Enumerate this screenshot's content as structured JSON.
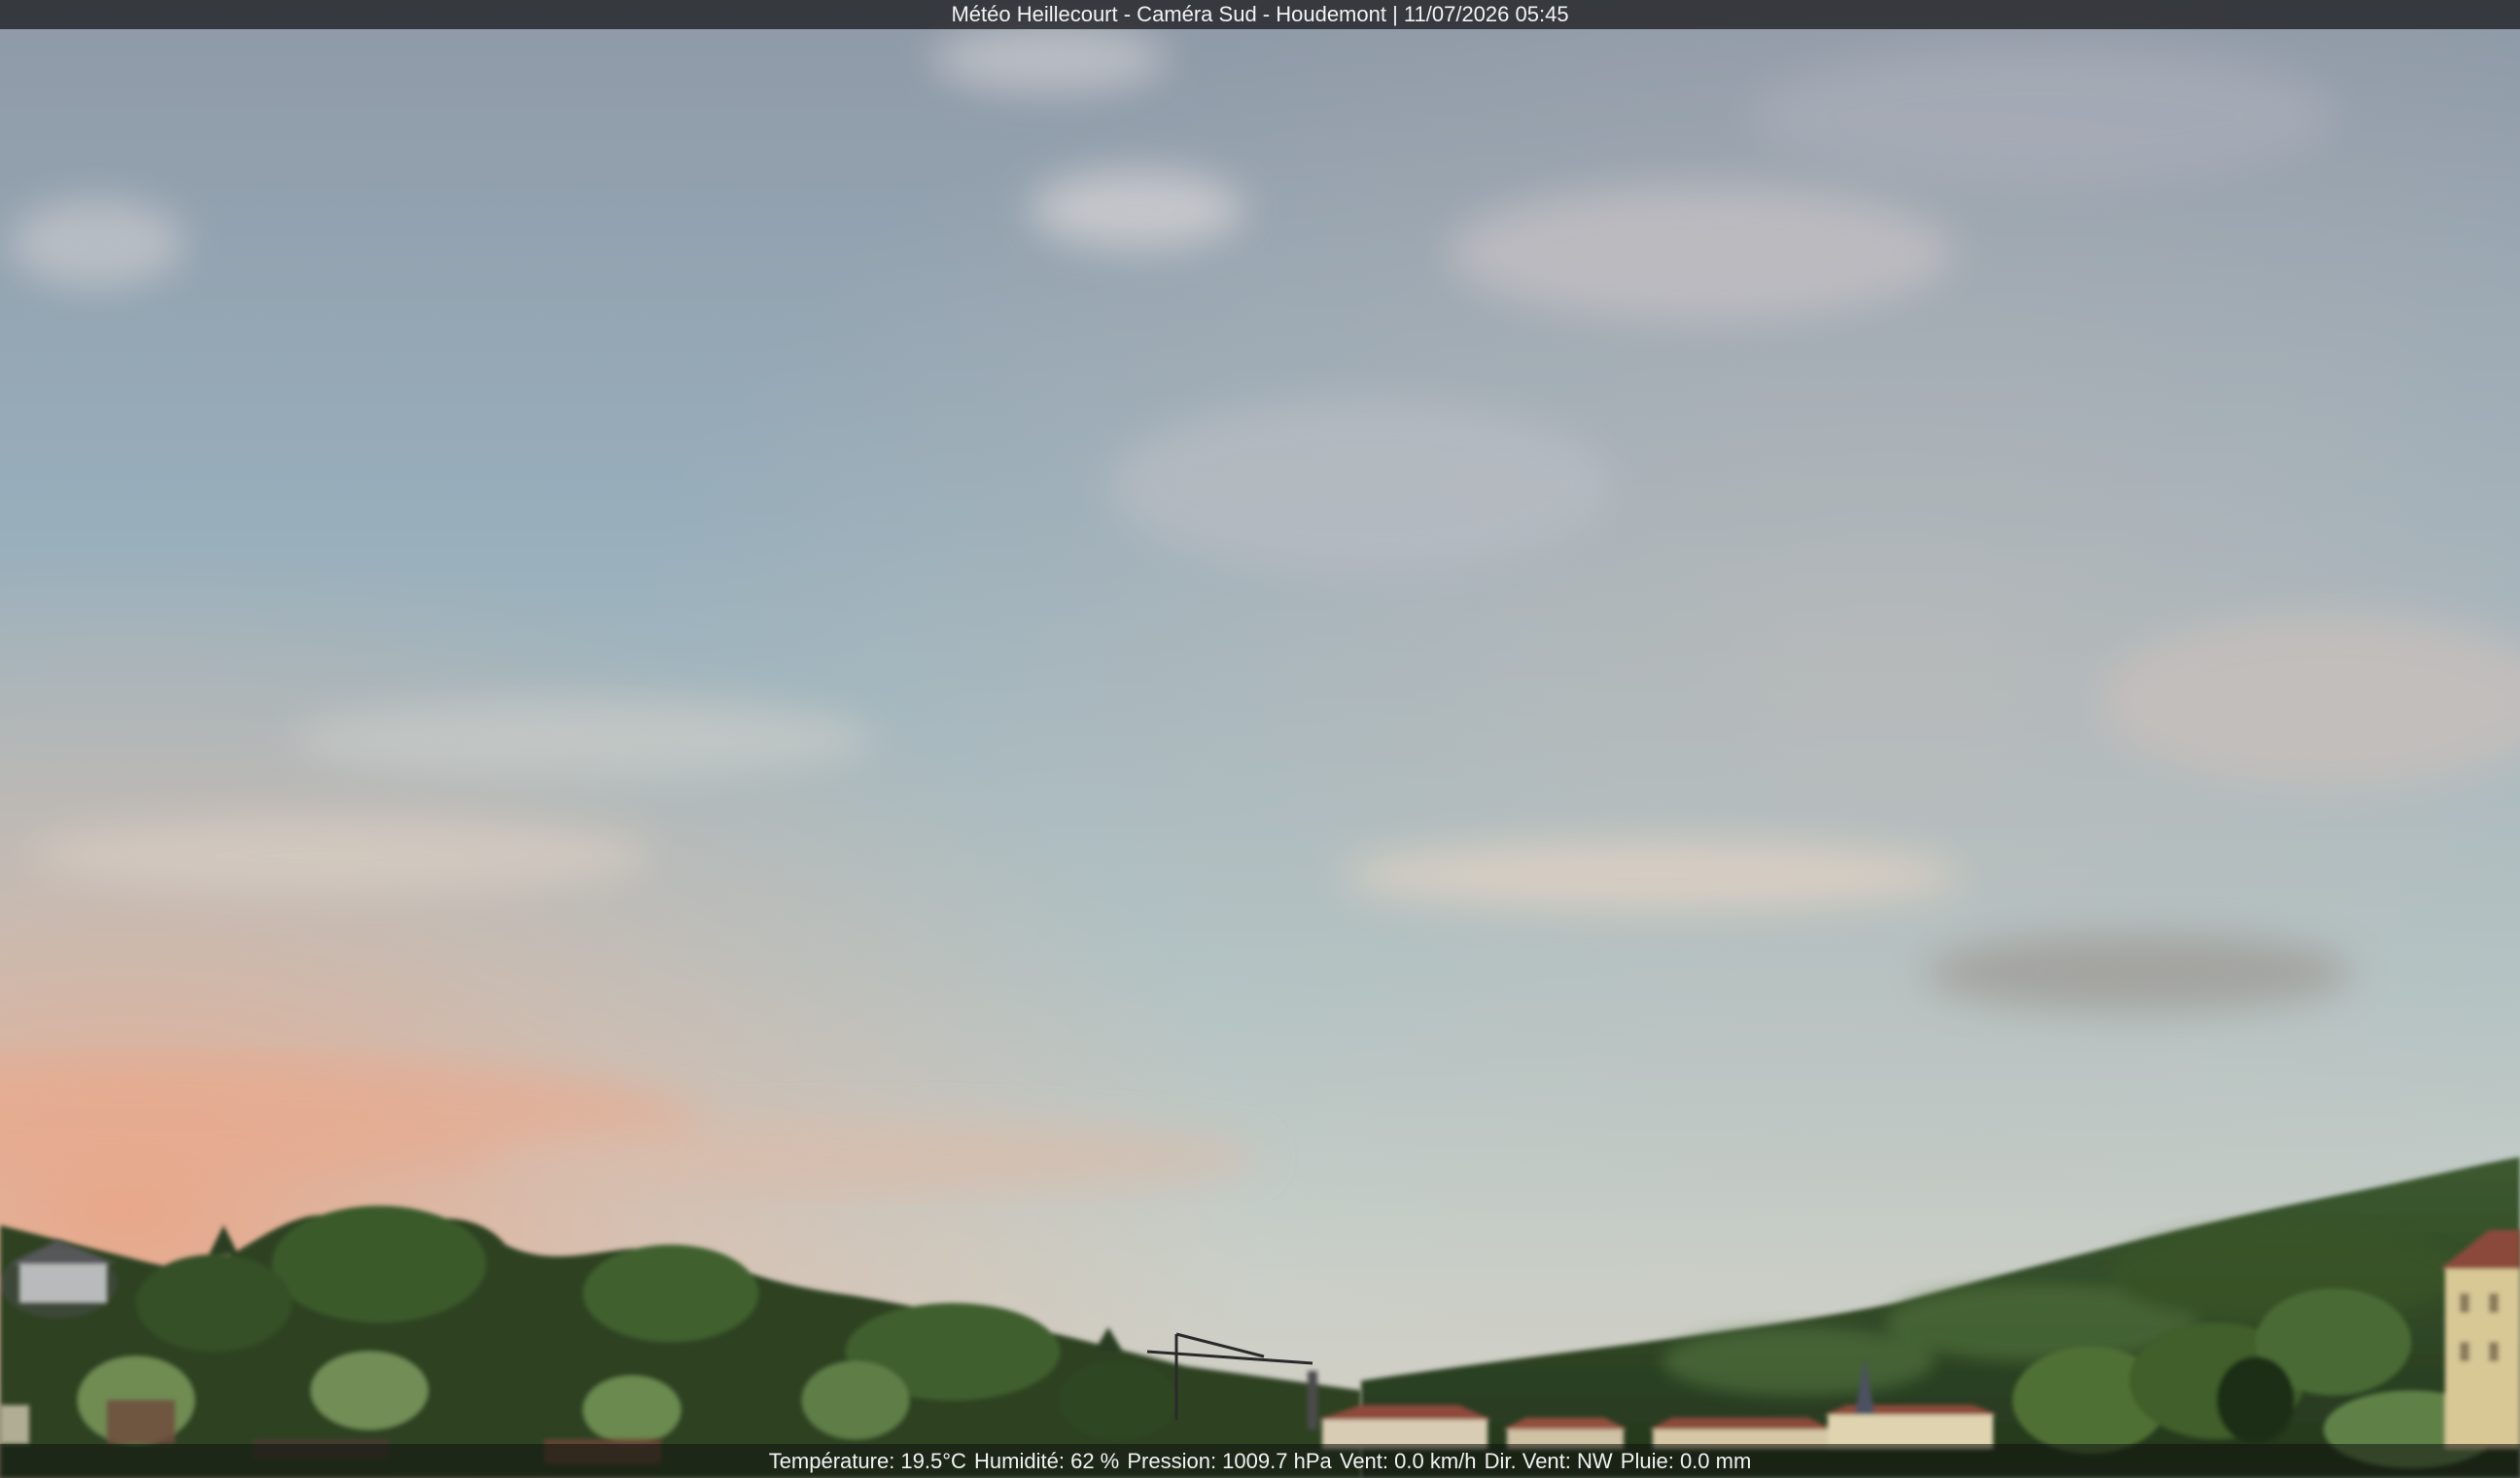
{
  "overlay": {
    "title": "Météo Heillecourt - Caméra Sud - Houdemont | 11/07/2026 05:45"
  },
  "weather": {
    "temperature": "Température: 19.5°C",
    "humidity": "Humidité: 62 %",
    "pressure": "Pression: 1009.7 hPa",
    "wind": "Vent: 0.0 km/h",
    "wind_direction": "Dir. Vent: NW",
    "rain": "Pluie: 0.0 mm"
  },
  "scene": {
    "sky_top": "#8e9aa8",
    "sky_mid": "#a9bcc3",
    "sky_horizon": "#c9c6bf",
    "sunrise_glow": "#e8a888",
    "vegetation_dark": "#2c3f22",
    "vegetation_light": "#5e7a3e",
    "roof": "#8b4a3a",
    "wall": "#d8c89a"
  }
}
